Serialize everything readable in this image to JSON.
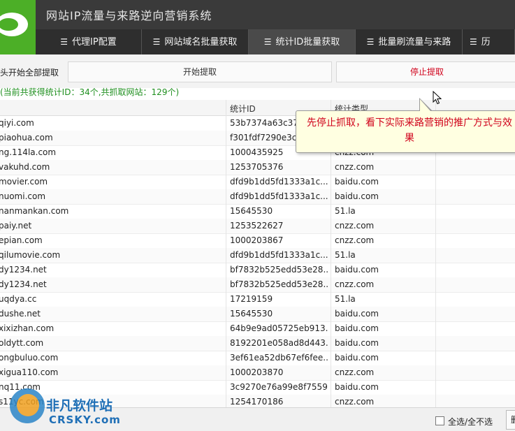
{
  "app": {
    "title": "网站IP流量与来路逆向营销系统"
  },
  "tabs": [
    {
      "label": "代理IP配置"
    },
    {
      "label": "网站域名批量获取"
    },
    {
      "label": "统计ID批量获取"
    },
    {
      "label": "批量刷流量与来路"
    },
    {
      "label": "历"
    }
  ],
  "toolbar": {
    "label": "头开始全部提取",
    "start_button": "开始提取",
    "stop_button": "停止提取"
  },
  "status_text": "(当前共获得统计ID：34个,共抓取网站：129个)",
  "table": {
    "headers": {
      "id": "统计ID",
      "type": "统计类型"
    },
    "rows": [
      {
        "site": "qiyi.com",
        "id": "53b7374a63c374",
        "type": ""
      },
      {
        "site": "piaohua.com",
        "id": "f301fdf7290e3c5",
        "type": ""
      },
      {
        "site": "ng.114la.com",
        "id": "1000435925",
        "type": "cnzz.com"
      },
      {
        "site": "vakuhd.com",
        "id": "1253705376",
        "type": "cnzz.com"
      },
      {
        "site": "movier.com",
        "id": "dfd9b1dd5fd1333a1c...",
        "type": "baidu.com"
      },
      {
        "site": "nuomi.com",
        "id": "dfd9b1dd5fd1333a1c...",
        "type": "baidu.com"
      },
      {
        "site": "nanmankan.com",
        "id": "15645530",
        "type": "51.la"
      },
      {
        "site": "paiy.net",
        "id": "1253522627",
        "type": "cnzz.com"
      },
      {
        "site": "epian.com",
        "id": "1000203867",
        "type": "cnzz.com"
      },
      {
        "site": "qilumovie.com",
        "id": "dfd9b1dd5fd1333a1c...",
        "type": "51.la"
      },
      {
        "site": "dy1234.net",
        "id": "bf7832b525edd53e28...",
        "type": "baidu.com"
      },
      {
        "site": "dy1234.net",
        "id": "bf7832b525edd53e28...",
        "type": "cnzz.com"
      },
      {
        "site": "uqdya.cc",
        "id": "17219159",
        "type": "51.la"
      },
      {
        "site": "dushe.net",
        "id": "15645530",
        "type": "baidu.com"
      },
      {
        "site": "xixizhan.com",
        "id": "64b9e9ad05725eb913...",
        "type": "baidu.com"
      },
      {
        "site": "oldytt.com",
        "id": "8192201e058ad8d443...",
        "type": "baidu.com"
      },
      {
        "site": "ongbuluo.com",
        "id": "3ef61ea52db67ef6fee...",
        "type": "baidu.com"
      },
      {
        "site": "xigua110.com",
        "id": "1000203870",
        "type": "cnzz.com"
      },
      {
        "site": "nq11.com",
        "id": "3c9270e76a99e8f7559...",
        "type": "baidu.com"
      },
      {
        "site": "s11yc.com",
        "id": "1254170186",
        "type": "cnzz.com"
      }
    ]
  },
  "tooltip": {
    "text": "先停止抓取，看下实际来路营销的推广方式与效果"
  },
  "footer": {
    "select_all_label": "全选/全不选",
    "delete_label": "删"
  },
  "watermark": {
    "text": "非凡软件站",
    "sub": "CRSKY.com"
  },
  "colors": {
    "accent_green": "#4caf27",
    "stop_red": "#d0021b",
    "status_green": "#1f8f1f",
    "tooltip_bg": "#ffffe1"
  }
}
